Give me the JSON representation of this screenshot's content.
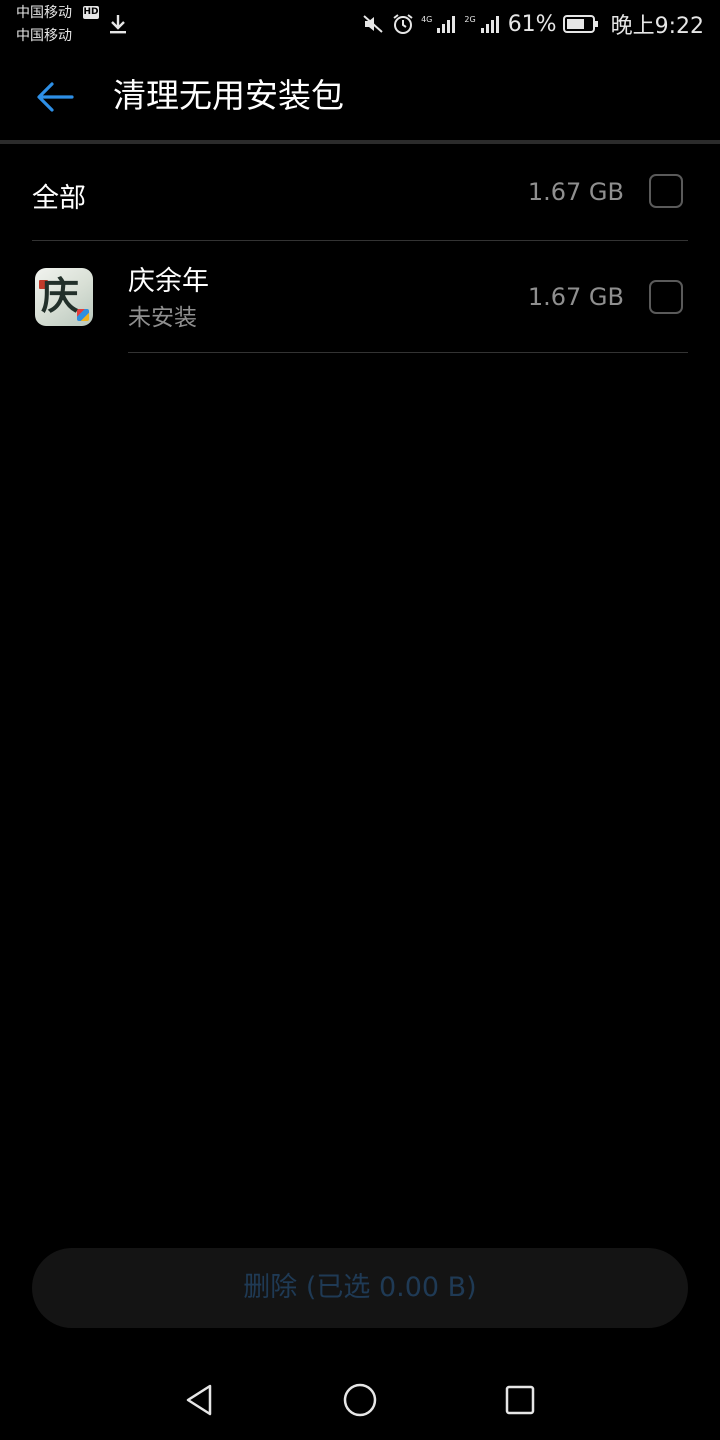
{
  "status_bar": {
    "carrier_1": "中国移动",
    "carrier_2": "中国移动",
    "hd_badge": "HD",
    "network_1": "4G",
    "network_2": "2G",
    "battery_percent": "61%",
    "time": "晚上9:22",
    "icons": [
      "download-icon",
      "mute-icon",
      "alarm-icon",
      "signal-icon",
      "signal-icon",
      "battery-icon"
    ]
  },
  "header": {
    "title": "清理无用安装包",
    "back_icon": "arrow-left-icon",
    "accent_color": "#2e8fe6"
  },
  "list": {
    "select_all": {
      "label": "全部",
      "size": "1.67 GB",
      "checked": false
    },
    "items": [
      {
        "name": "庆余年",
        "status": "未安装",
        "size": "1.67 GB",
        "checked": false,
        "icon": "qingyunian-app-icon"
      }
    ]
  },
  "footer": {
    "delete_label": "删除 (已选 0.00 B)",
    "enabled": false
  },
  "navigation": {
    "icons": [
      "nav-back-triangle-icon",
      "nav-home-circle-icon",
      "nav-recent-square-icon"
    ]
  }
}
